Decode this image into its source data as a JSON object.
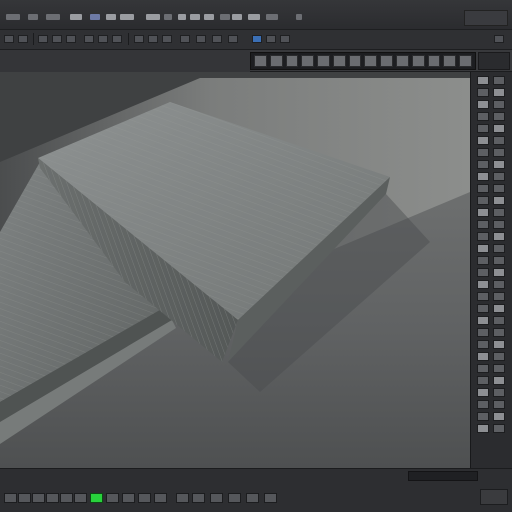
{
  "app": {
    "kind": "3d-modeling-editor",
    "accent_color": "#3b6fb5",
    "active_indicator_color": "#28d33c"
  },
  "menubar": {
    "icons": [
      "menu-item",
      "menu-item",
      "menu-item",
      "menu-item",
      "menu-item",
      "menu-item",
      "menu-item",
      "menu-item",
      "menu-item",
      "menu-item",
      "menu-item"
    ]
  },
  "toolbar": {
    "active_tool": "select-tool"
  },
  "viewport": {
    "content": "3d-render",
    "objects": [
      "stacked-folded-mattress-left",
      "folded-mattress-top",
      "floor-plane",
      "back-wall"
    ]
  },
  "right_panel": {
    "icon": "property-icons"
  },
  "bottombar": {
    "play_state": "active"
  }
}
